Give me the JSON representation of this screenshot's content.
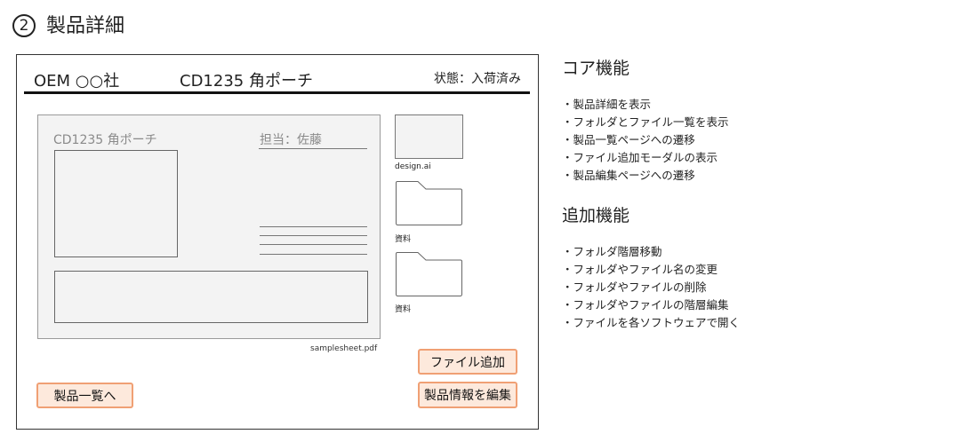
{
  "heading": {
    "number": "2",
    "title": "製品詳細"
  },
  "header": {
    "company": "OEM ○○社",
    "product": "CD1235 角ポーチ",
    "status": "状態：入荷済み"
  },
  "card": {
    "title": "CD1235 角ポーチ",
    "owner": "担当：佐藤",
    "pdf_name": "samplesheet.pdf"
  },
  "files": [
    {
      "name": "design.ai",
      "icon": "file-thumbnail"
    },
    {
      "name": "資料",
      "icon": "folder-icon"
    },
    {
      "name": "資料",
      "icon": "folder-icon"
    }
  ],
  "buttons": {
    "add_file": "ファイル追加",
    "edit_product": "製品情報を編集",
    "product_list": "製品一覧へ"
  },
  "core": {
    "title": "コア機能",
    "items": [
      "・製品詳細を表示",
      "・フォルダとファイル一覧を表示",
      "・製品一覧ページへの遷移",
      "・ファイル追加モーダルの表示",
      "・製品編集ページへの遷移"
    ]
  },
  "extra": {
    "title": "追加機能",
    "items": [
      "・フォルダ階層移動",
      "・フォルダやファイル名の変更",
      "・フォルダやファイルの削除",
      "・フォルダやファイルの階層編集",
      "・ファイルを各ソフトウェアで開く"
    ]
  },
  "colors": {
    "button_fill": "#fde9dc",
    "button_border": "#f0a074",
    "card_bg": "#f3f3f3"
  }
}
